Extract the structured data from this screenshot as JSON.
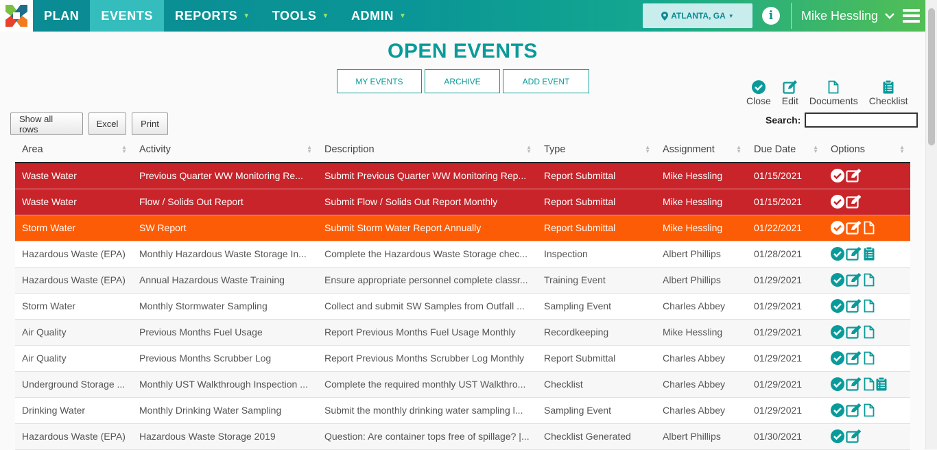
{
  "nav": {
    "items": [
      {
        "label": "PLAN",
        "caret": false,
        "active": false
      },
      {
        "label": "EVENTS",
        "caret": false,
        "active": true
      },
      {
        "label": "REPORTS",
        "caret": true,
        "active": false
      },
      {
        "label": "TOOLS",
        "caret": true,
        "active": false
      },
      {
        "label": "ADMIN",
        "caret": true,
        "active": false
      }
    ],
    "location": "ATLANTA, GA",
    "user": "Mike Hessling"
  },
  "page": {
    "title": "OPEN EVENTS",
    "buttons": {
      "my_events": "MY EVENTS",
      "archive": "ARCHIVE",
      "add_event": "ADD EVENT"
    },
    "legend": {
      "close": "Close",
      "edit": "Edit",
      "documents": "Documents",
      "checklist": "Checklist"
    },
    "toolbar": {
      "show_all": "Show all rows",
      "excel": "Excel",
      "print": "Print"
    },
    "search_label": "Search:"
  },
  "colors": {
    "accent": "#0b9a9a",
    "overdue": "#c8242a",
    "due_soon": "#fc5c05"
  },
  "table": {
    "columns": [
      "Area",
      "Activity",
      "Description",
      "Type",
      "Assignment",
      "Due Date",
      "Options"
    ],
    "rows": [
      {
        "status": "red",
        "area": "Waste Water",
        "activity": "Previous Quarter WW Monitoring Re...",
        "description": "Submit Previous Quarter WW Monitoring Rep...",
        "type": "Report Submittal",
        "assignment": "Mike Hessling",
        "due": "01/15/2021",
        "options": [
          "close",
          "edit"
        ]
      },
      {
        "status": "red",
        "area": "Waste Water",
        "activity": "Flow / Solids Out Report",
        "description": "Submit Flow / Solids Out Report Monthly",
        "type": "Report Submittal",
        "assignment": "Mike Hessling",
        "due": "01/15/2021",
        "options": [
          "close",
          "edit"
        ]
      },
      {
        "status": "orange",
        "area": "Storm Water",
        "activity": "SW Report",
        "description": "Submit Storm Water Report Annually",
        "type": "Report Submittal",
        "assignment": "Mike Hessling",
        "due": "01/22/2021",
        "options": [
          "close",
          "edit",
          "document"
        ]
      },
      {
        "status": "normal",
        "area": "Hazardous Waste (EPA)",
        "activity": "Monthly Hazardous Waste Storage In...",
        "description": "Complete the Hazardous Waste Storage chec...",
        "type": "Inspection",
        "assignment": "Albert Phillips",
        "due": "01/28/2021",
        "options": [
          "close",
          "edit",
          "checklist"
        ]
      },
      {
        "status": "normal",
        "area": "Hazardous Waste (EPA)",
        "activity": "Annual Hazardous Waste Training",
        "description": "Ensure appropriate personnel complete classr...",
        "type": "Training Event",
        "assignment": "Albert Phillips",
        "due": "01/29/2021",
        "options": [
          "close",
          "edit",
          "document"
        ]
      },
      {
        "status": "normal",
        "area": "Storm Water",
        "activity": "Monthly Stormwater Sampling",
        "description": "Collect and submit SW Samples from Outfall ...",
        "type": "Sampling Event",
        "assignment": "Charles Abbey",
        "due": "01/29/2021",
        "options": [
          "close",
          "edit",
          "document"
        ]
      },
      {
        "status": "normal",
        "area": "Air Quality",
        "activity": "Previous Months Fuel Usage",
        "description": "Report Previous Months Fuel Usage Monthly",
        "type": "Recordkeeping",
        "assignment": "Mike Hessling",
        "due": "01/29/2021",
        "options": [
          "close",
          "edit",
          "document"
        ]
      },
      {
        "status": "normal",
        "area": "Air Quality",
        "activity": "Previous Months Scrubber Log",
        "description": "Report Previous Months Scrubber Log Monthly",
        "type": "Report Submittal",
        "assignment": "Charles Abbey",
        "due": "01/29/2021",
        "options": [
          "close",
          "edit",
          "document"
        ]
      },
      {
        "status": "normal",
        "area": "Underground Storage ...",
        "activity": "Monthly UST Walkthrough Inspection ...",
        "description": "Complete the required monthly UST Walkthro...",
        "type": "Checklist",
        "assignment": "Charles Abbey",
        "due": "01/29/2021",
        "options": [
          "close",
          "edit",
          "document",
          "checklist"
        ]
      },
      {
        "status": "normal",
        "area": "Drinking Water",
        "activity": "Monthly Drinking Water Sampling",
        "description": "Submit the monthly drinking water sampling l...",
        "type": "Sampling Event",
        "assignment": "Charles Abbey",
        "due": "01/29/2021",
        "options": [
          "close",
          "edit",
          "document"
        ]
      },
      {
        "status": "normal",
        "area": "Hazardous Waste (EPA)",
        "activity": "Hazardous Waste Storage 2019",
        "description": "Question: Are container tops free of spillage? |...",
        "type": "Checklist Generated",
        "assignment": "Albert Phillips",
        "due": "01/30/2021",
        "options": [
          "close",
          "edit"
        ]
      }
    ]
  }
}
